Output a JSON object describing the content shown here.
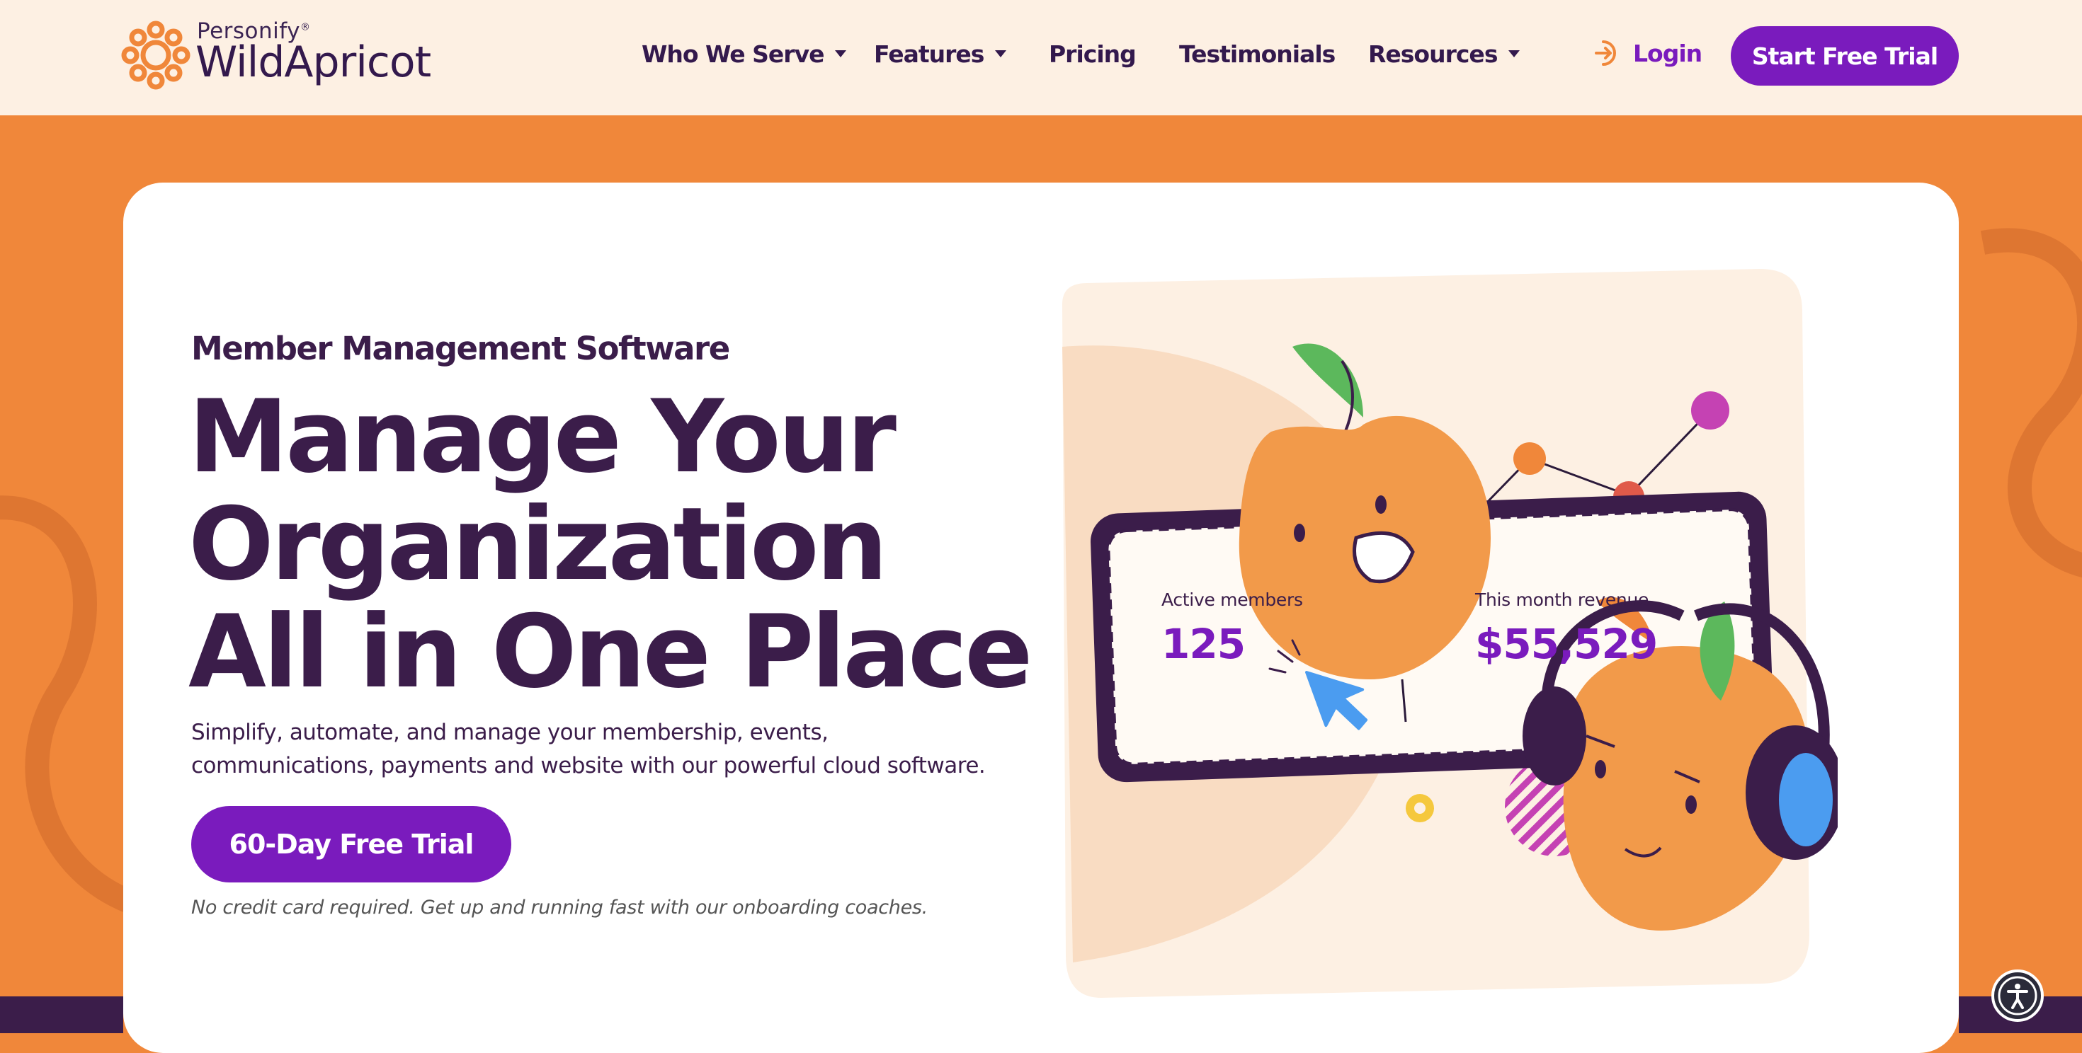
{
  "brand": {
    "parent": "Personify",
    "name": "WildApricot"
  },
  "nav": {
    "items": [
      {
        "label": "Who We Serve",
        "dropdown": true
      },
      {
        "label": "Features",
        "dropdown": true
      },
      {
        "label": "Pricing",
        "dropdown": false
      },
      {
        "label": "Testimonials",
        "dropdown": false
      },
      {
        "label": "Resources",
        "dropdown": true
      }
    ],
    "login_label": "Login",
    "cta_label": "Start Free Trial"
  },
  "hero": {
    "eyebrow": "Member Management Software",
    "headline": "Manage Your Organization All in One Place",
    "subtext": "Simplify, automate, and manage your membership, events, communications, payments and website with our powerful cloud software.",
    "cta_label": "60-Day Free Trial",
    "note": "No credit card required. Get up and running fast with our onboarding coaches."
  },
  "dashboard": {
    "active_members_label": "Active members",
    "active_members_value": "125",
    "revenue_label": "This month revenue",
    "revenue_value": "$55,529"
  },
  "icons": [
    "logo-flower-icon",
    "caret-down-icon",
    "login-arrow-icon",
    "cursor-pointer-icon",
    "gear-icon",
    "accessibility-icon"
  ],
  "colors": {
    "orange_bg": "#f0873a",
    "header_bg": "#fdf0e3",
    "purple": "#7a1bbd",
    "dark_purple": "#3b1d4a",
    "apricot": "#f29a4a",
    "leaf_green": "#5cb85c",
    "cursor_blue": "#4b9cf0"
  }
}
